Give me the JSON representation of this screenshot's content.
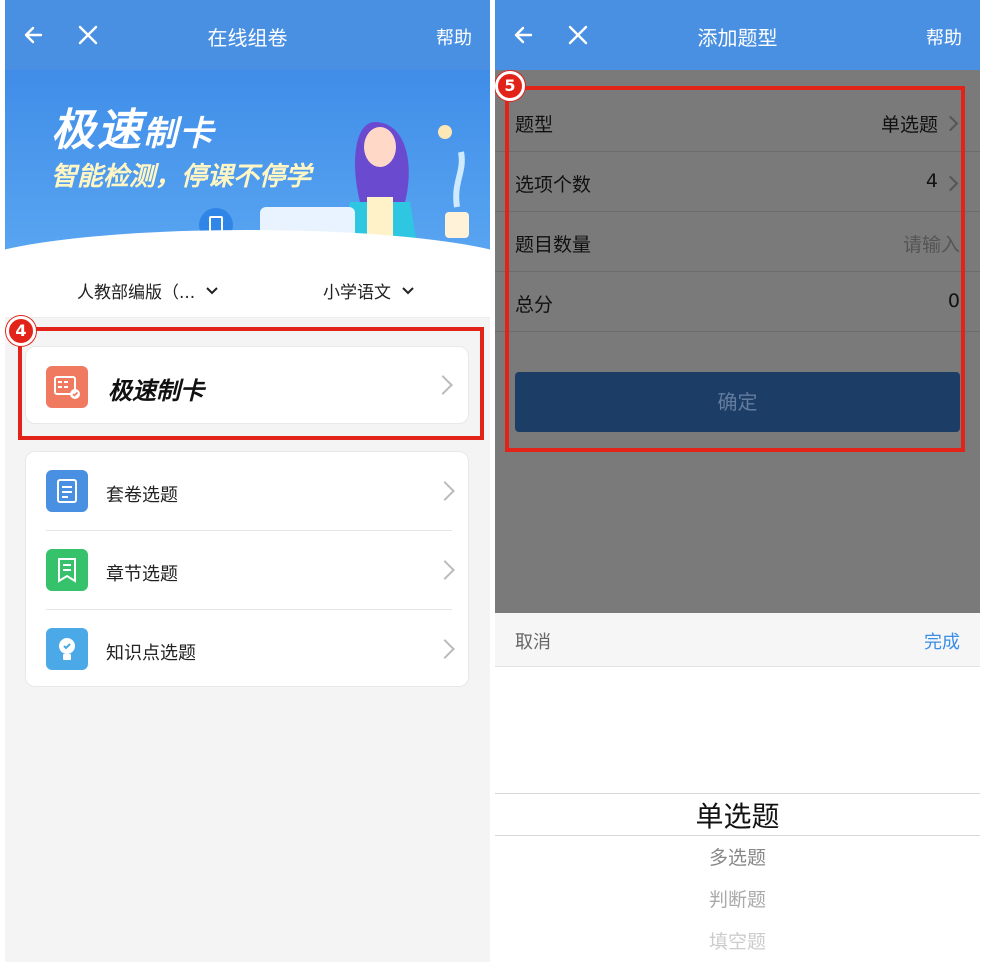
{
  "left": {
    "nav": {
      "title": "在线组卷",
      "help": "帮助"
    },
    "banner": {
      "title_a": "极速",
      "title_b": "制卡",
      "slogan": "智能检测，停课不停学"
    },
    "filters": {
      "edition": "人教部编版（...",
      "subject": "小学语文"
    },
    "quick": {
      "label": "极速制卡"
    },
    "menu": [
      {
        "label": "套卷选题",
        "color": "#4a90e2"
      },
      {
        "label": "章节选题",
        "color": "#36c26b"
      },
      {
        "label": "知识点选题",
        "color": "#4aa9e6"
      }
    ],
    "badge": "4"
  },
  "right": {
    "nav": {
      "title": "添加题型",
      "help": "帮助"
    },
    "form": {
      "type": {
        "label": "题型",
        "value": "单选题"
      },
      "options": {
        "label": "选项个数",
        "value": "4"
      },
      "count": {
        "label": "题目数量",
        "placeholder": "请输入"
      },
      "score": {
        "label": "总分",
        "value": "0"
      }
    },
    "confirm": "确定",
    "picker": {
      "cancel": "取消",
      "done": "完成",
      "selected": "单选题",
      "options": [
        "多选题",
        "判断题",
        "填空题"
      ]
    },
    "badge": "5"
  },
  "colors": {
    "primary": "#4a90e2",
    "highlight": "#e2231a",
    "confirm": "#1c3d66"
  }
}
